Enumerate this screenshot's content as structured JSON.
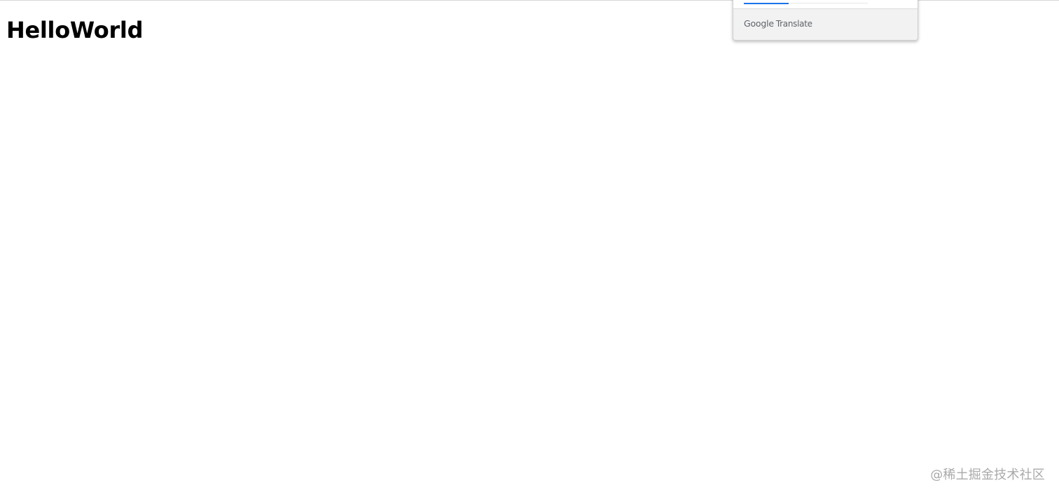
{
  "heading": "HelloWorld",
  "translate_popup": {
    "tabs": [
      {
        "label": ""
      },
      {
        "label": ""
      }
    ],
    "accent_color": "#1a73e8",
    "footer": {
      "google": "Google",
      "translate": "Translate"
    }
  },
  "watermark": "@稀土掘金技术社区"
}
